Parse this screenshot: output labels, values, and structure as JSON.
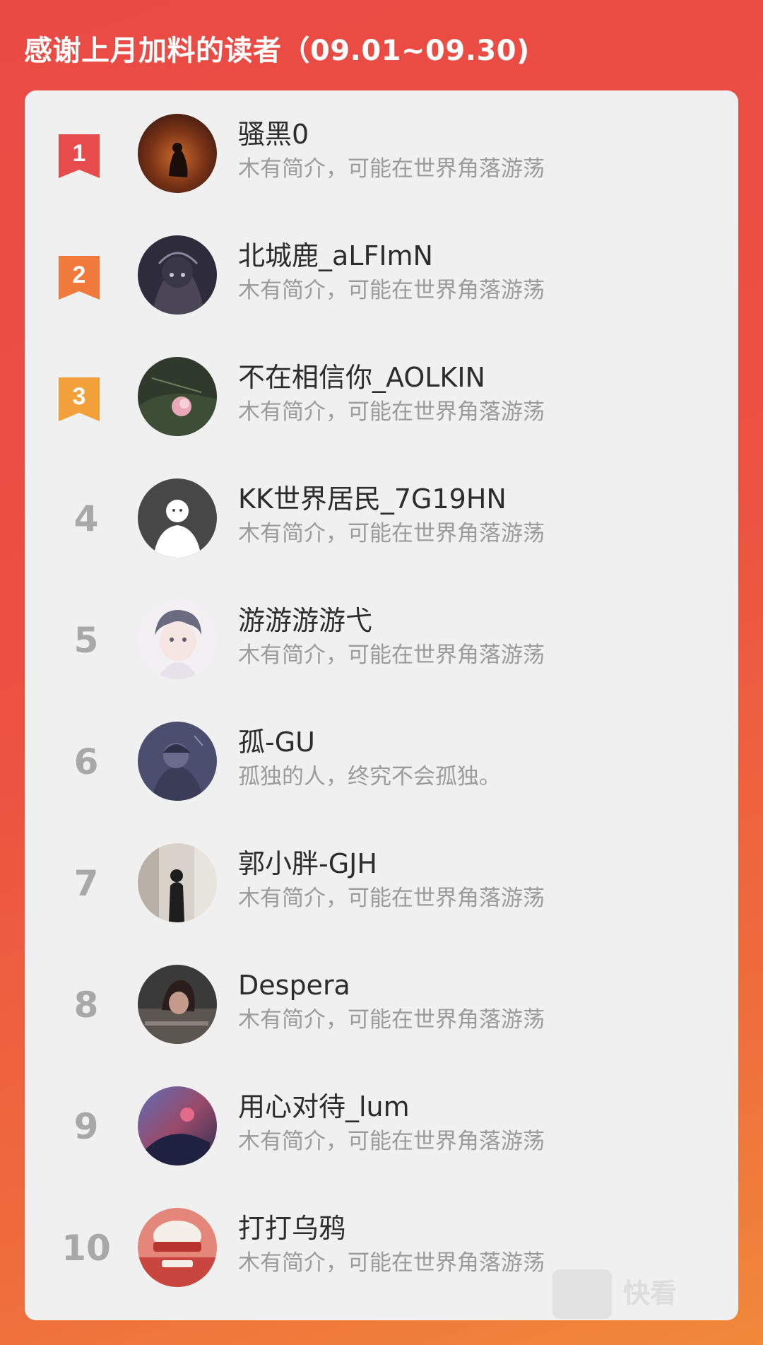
{
  "header": {
    "title": "感谢上月加料的读者（09.01~09.30)"
  },
  "badge_colors": [
    "#e84b4b",
    "#f07a3c",
    "#f2a13a"
  ],
  "readers": [
    {
      "rank": "1",
      "name": "骚黑0",
      "bio": "木有简介，可能在世界角落游荡"
    },
    {
      "rank": "2",
      "name": "北城鹿_aLFImN",
      "bio": "木有简介，可能在世界角落游荡"
    },
    {
      "rank": "3",
      "name": "不在相信你_AOLKIN",
      "bio": "木有简介，可能在世界角落游荡"
    },
    {
      "rank": "4",
      "name": "KK世界居民_7G19HN",
      "bio": "木有简介，可能在世界角落游荡"
    },
    {
      "rank": "5",
      "name": "游游游游弋",
      "bio": "木有简介，可能在世界角落游荡"
    },
    {
      "rank": "6",
      "name": "孤-GU",
      "bio": "孤独的人，终究不会孤独。"
    },
    {
      "rank": "7",
      "name": "郭小胖-GJH",
      "bio": "木有简介，可能在世界角落游荡"
    },
    {
      "rank": "8",
      "name": "Despera",
      "bio": "木有简介，可能在世界角落游荡"
    },
    {
      "rank": "9",
      "name": "用心对待_lum",
      "bio": "木有简介，可能在世界角落游荡"
    },
    {
      "rank": "10",
      "name": "打打乌鸦",
      "bio": "木有简介，可能在世界角落游荡"
    }
  ],
  "watermark": {
    "text": "快看"
  }
}
